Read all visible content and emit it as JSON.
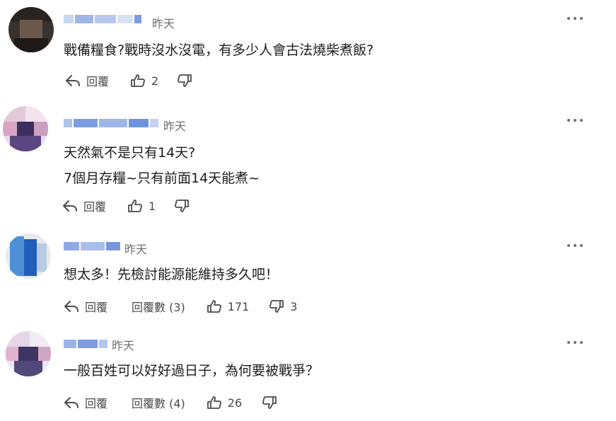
{
  "more_icon": "more-horizontal-icon",
  "reply_icon": "reply-arrow-icon",
  "like_icon": "thumbs-up-icon",
  "dislike_icon": "thumbs-down-icon",
  "comments": [
    {
      "time": "昨天",
      "lines": [
        "戰備糧食?戰時沒水沒電，有多少人會古法燒柴煮飯?"
      ],
      "reply_label": "回覆",
      "replies_label": "",
      "likes": "2",
      "dislikes": ""
    },
    {
      "time": "昨天",
      "lines": [
        "天然氣不是只有14天?",
        "7個月存糧~只有前面14天能煮~"
      ],
      "reply_label": "回覆",
      "replies_label": "",
      "likes": "1",
      "dislikes": ""
    },
    {
      "time": "昨天",
      "lines": [
        "想太多！先檢討能源能維持多久吧！"
      ],
      "reply_label": "回覆",
      "replies_label": "回覆數 (3)",
      "likes": "171",
      "dislikes": "3"
    },
    {
      "time": "昨天",
      "lines": [
        "一般百姓可以好好過日子，為何要被戰爭？"
      ],
      "reply_label": "回覆",
      "replies_label": "回覆數 (4)",
      "likes": "26",
      "dislikes": ""
    }
  ]
}
